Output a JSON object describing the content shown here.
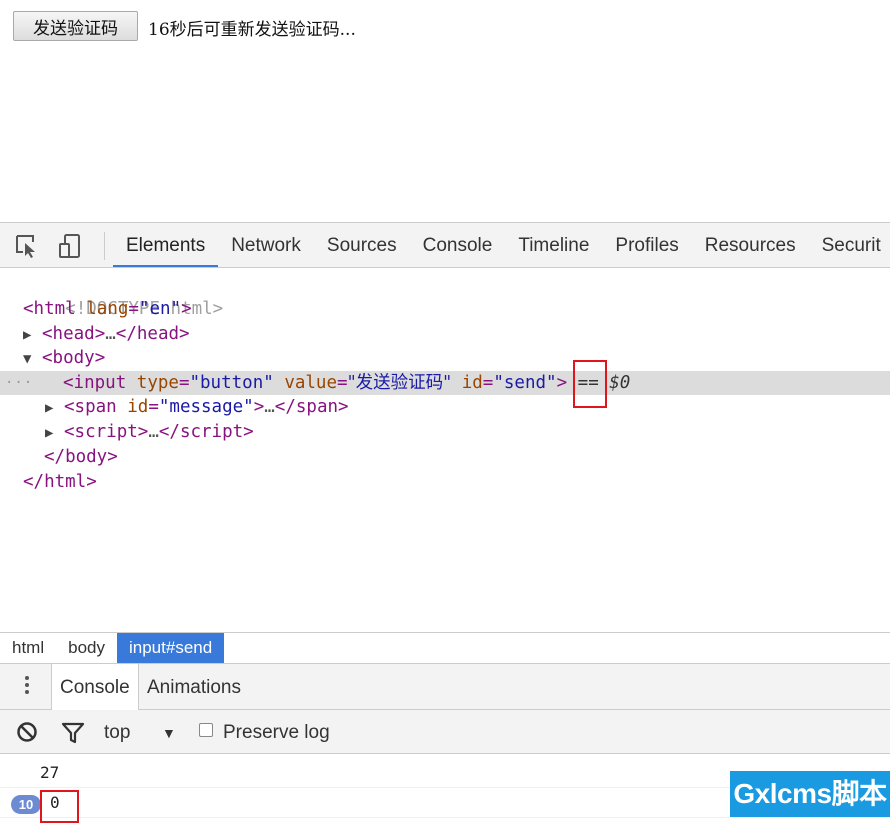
{
  "page": {
    "send_button_label": "发送验证码",
    "countdown_text": "16秒后可重新发送验证码..."
  },
  "devtools": {
    "tabs": [
      "Elements",
      "Network",
      "Sources",
      "Console",
      "Timeline",
      "Profiles",
      "Resources",
      "Securit"
    ],
    "active_tab": "Elements",
    "accent_color": "#3879d9"
  },
  "dom": {
    "doctype": "<!DOCTYPE html>",
    "html_open_tag": "html",
    "html_lang_attr": "lang",
    "html_lang_value": "\"en\"",
    "head_tag": "head",
    "body_tag": "body",
    "input_tag": "input",
    "input_type_attr": "type",
    "input_type_value": "\"button\"",
    "input_value_attr": "value",
    "input_value_value": "\"发送验证码\"",
    "input_id_attr": "id",
    "input_id_value": "\"send\"",
    "selected_marker": "== $0",
    "span_tag": "span",
    "span_id_attr": "id",
    "span_id_value": "\"message\"",
    "script_tag": "script",
    "ellipsis": "…",
    "row_menu": "···"
  },
  "breadcrumbs": [
    "html",
    "body",
    "input#send"
  ],
  "drawer": {
    "tabs": [
      "Console",
      "Animations"
    ],
    "active_tab": "Console"
  },
  "console_toolbar": {
    "context": "top",
    "preserve_log_label": "Preserve log",
    "preserve_log_checked": false
  },
  "console_output": [
    {
      "text": "27",
      "repeat_count": null
    },
    {
      "text": "0",
      "repeat_count": "10"
    }
  ],
  "watermark": {
    "text": "Gxlcms脚本"
  }
}
